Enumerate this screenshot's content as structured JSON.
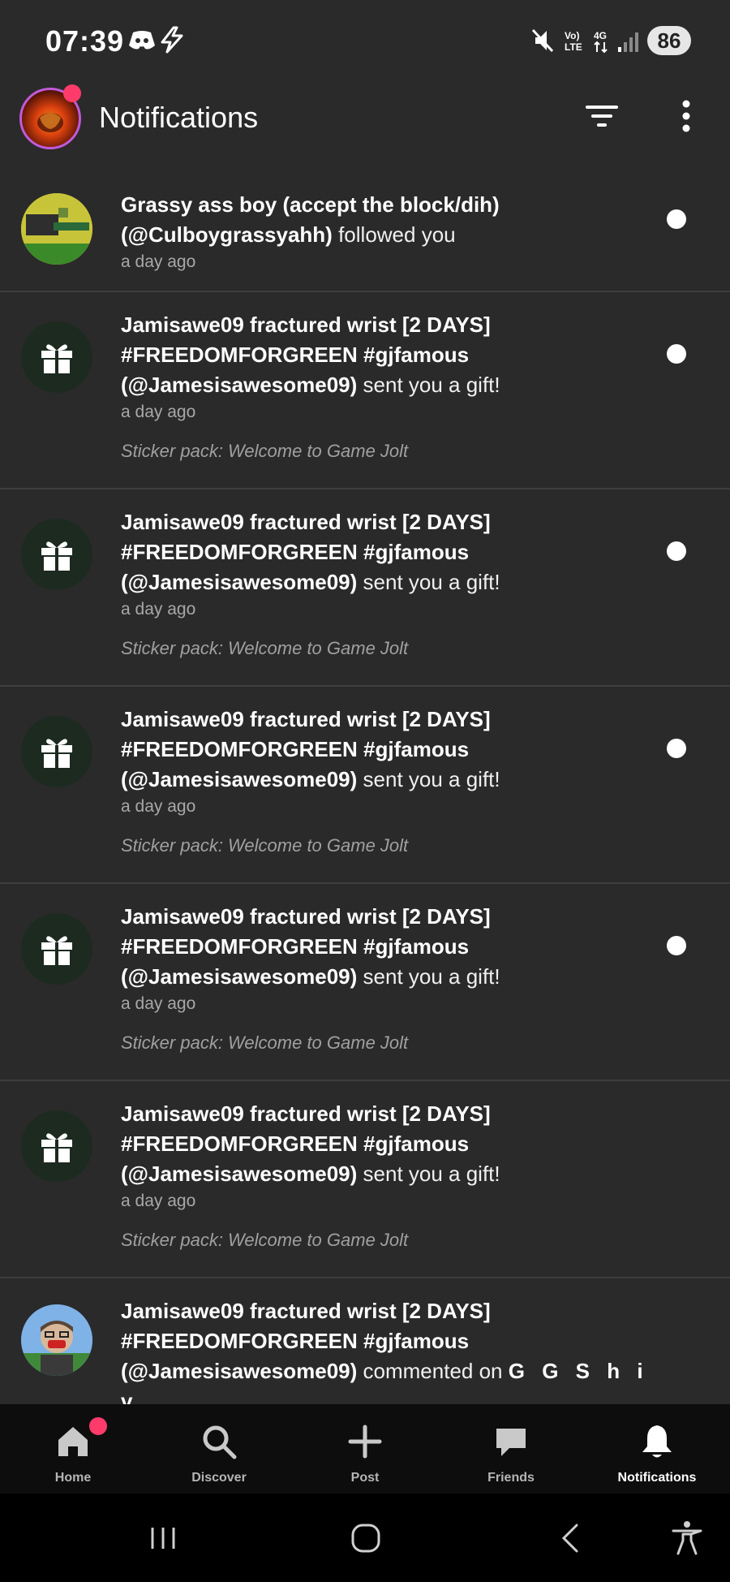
{
  "status_bar": {
    "time": "07:39",
    "battery": "86",
    "icons": [
      "discord-icon",
      "bolt-icon",
      "mute-icon",
      "volte-icon",
      "4g-icon",
      "signal-icon"
    ]
  },
  "header": {
    "title": "Notifications",
    "accent_badge_color": "#ff3b6b"
  },
  "notifications": [
    {
      "name": "Grassy ass boy (accept the block/dih)",
      "handle": "(@Culboygrassyahh)",
      "action": "followed you",
      "time": "a day ago",
      "detail": "",
      "unread": true,
      "avatar": "user-avatar"
    },
    {
      "name": "Jamisawe09 fractured wrist [2 DAYS] #FREEDOMFORGREEN #gjfamous",
      "handle": "(@Jamesisawesome09)",
      "action": "sent you a gift!",
      "time": "a day ago",
      "detail": "Sticker pack: Welcome to Game Jolt",
      "unread": true,
      "avatar": "gift-icon"
    },
    {
      "name": "Jamisawe09 fractured wrist [2 DAYS] #FREEDOMFORGREEN #gjfamous",
      "handle": "(@Jamesisawesome09)",
      "action": "sent you a gift!",
      "time": "a day ago",
      "detail": "Sticker pack: Welcome to Game Jolt",
      "unread": true,
      "avatar": "gift-icon"
    },
    {
      "name": "Jamisawe09 fractured wrist [2 DAYS] #FREEDOMFORGREEN #gjfamous",
      "handle": "(@Jamesisawesome09)",
      "action": "sent you a gift!",
      "time": "a day ago",
      "detail": "Sticker pack: Welcome to Game Jolt",
      "unread": true,
      "avatar": "gift-icon"
    },
    {
      "name": "Jamisawe09 fractured wrist [2 DAYS] #FREEDOMFORGREEN #gjfamous",
      "handle": "(@Jamesisawesome09)",
      "action": "sent you a gift!",
      "time": "a day ago",
      "detail": "Sticker pack: Welcome to Game Jolt",
      "unread": true,
      "avatar": "gift-icon"
    },
    {
      "name": "Jamisawe09 fractured wrist [2 DAYS] #FREEDOMFORGREEN #gjfamous",
      "handle": "(@Jamesisawesome09)",
      "action": "sent you a gift!",
      "time": "a day ago",
      "detail": "Sticker pack: Welcome to Game Jolt",
      "unread": false,
      "avatar": "gift-icon"
    },
    {
      "name": "Jamisawe09 fractured wrist [2 DAYS] #FREEDOMFORGREEN #gjfamous",
      "handle": "(@Jamesisawesome09)",
      "action": "commented on",
      "target": "G G  S h i v",
      "time": "",
      "detail": "",
      "unread": false,
      "avatar": "user-avatar"
    }
  ],
  "bottom_nav": {
    "items": [
      {
        "label": "Home",
        "icon": "home-icon",
        "badge": true
      },
      {
        "label": "Discover",
        "icon": "search-icon",
        "badge": false
      },
      {
        "label": "Post",
        "icon": "plus-icon",
        "badge": false
      },
      {
        "label": "Friends",
        "icon": "chat-icon",
        "badge": false
      },
      {
        "label": "Notifications",
        "icon": "bell-icon",
        "badge": false,
        "active": true
      }
    ]
  }
}
